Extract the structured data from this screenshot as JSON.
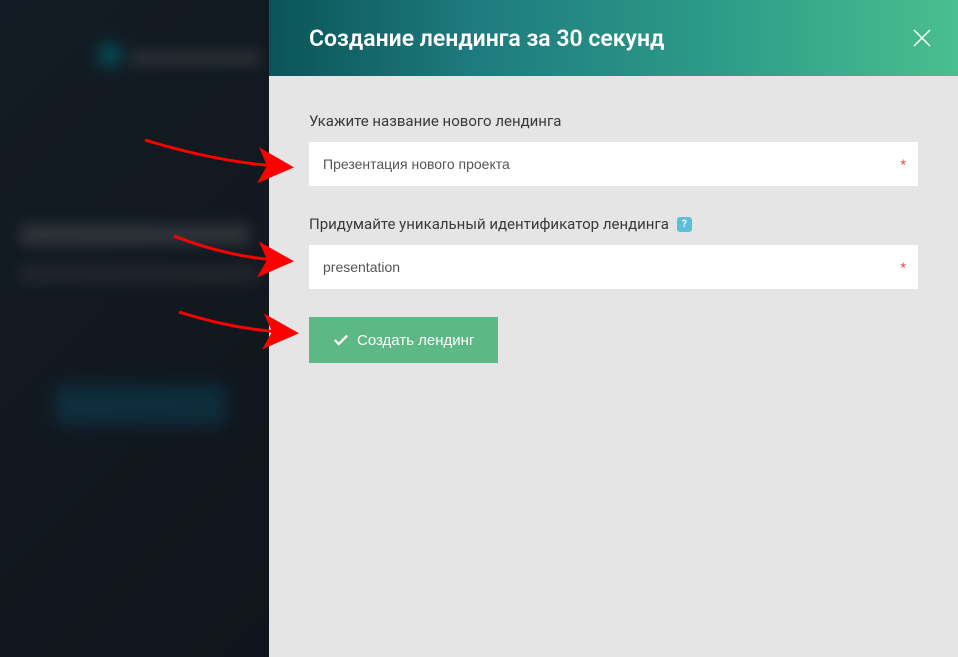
{
  "modal": {
    "title": "Создание лендинга за 30 секунд",
    "fields": {
      "name": {
        "label": "Укажите название нового лендинга",
        "value": "Презентация нового проекта",
        "required": true
      },
      "identifier": {
        "label": "Придумайте уникальный идентификатор лендинга",
        "value": "presentation",
        "required": true,
        "has_help": true,
        "help_text": "?"
      }
    },
    "submit_label": "Создать лендинг"
  },
  "icons": {
    "close": "close-icon",
    "checkmark": "checkmark-icon",
    "help": "help-icon"
  },
  "colors": {
    "header_gradient_start": "#0a5458",
    "header_gradient_end": "#4abf8f",
    "submit_button": "#5cb884",
    "help_badge": "#5cbfda",
    "required": "#e74c3c",
    "panel_bg": "#e5e5e5"
  }
}
